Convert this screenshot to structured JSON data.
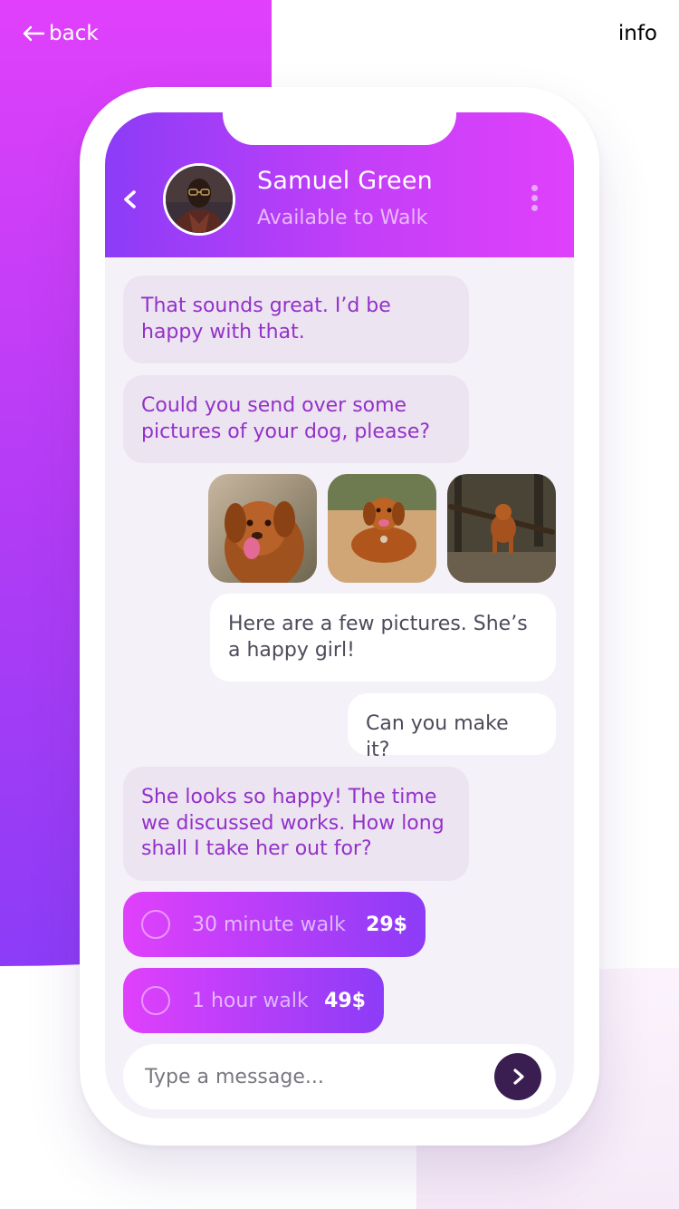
{
  "page": {
    "back_label": "back",
    "info_label": "info"
  },
  "contact": {
    "name": "Samuel Green",
    "status": "Available to Walk"
  },
  "messages": [
    {
      "side": "in",
      "text": "That sounds great. I’d be happy with that."
    },
    {
      "side": "in",
      "text": "Could you send over some pictures of your dog, please?"
    },
    {
      "side": "out",
      "text": "Here are a few pictures. She’s a happy girl!"
    },
    {
      "side": "out",
      "text": "Can you make it?"
    },
    {
      "side": "in",
      "text": "She looks so happy! The time we discussed works. How long shall I take her out for?"
    }
  ],
  "photos": [
    "dog-photo-1",
    "dog-photo-2",
    "dog-photo-3"
  ],
  "options": [
    {
      "label": "30 minute walk",
      "price": "29$"
    },
    {
      "label": "1 hour walk",
      "price": "49$"
    }
  ],
  "composer": {
    "placeholder": "Type a message..."
  },
  "colors": {
    "accent_start": "#e040fb",
    "accent_end": "#8c3cf7",
    "incoming_bubble": "#ece4f1",
    "incoming_text": "#9331c9",
    "send_button": "#3a1e51"
  }
}
